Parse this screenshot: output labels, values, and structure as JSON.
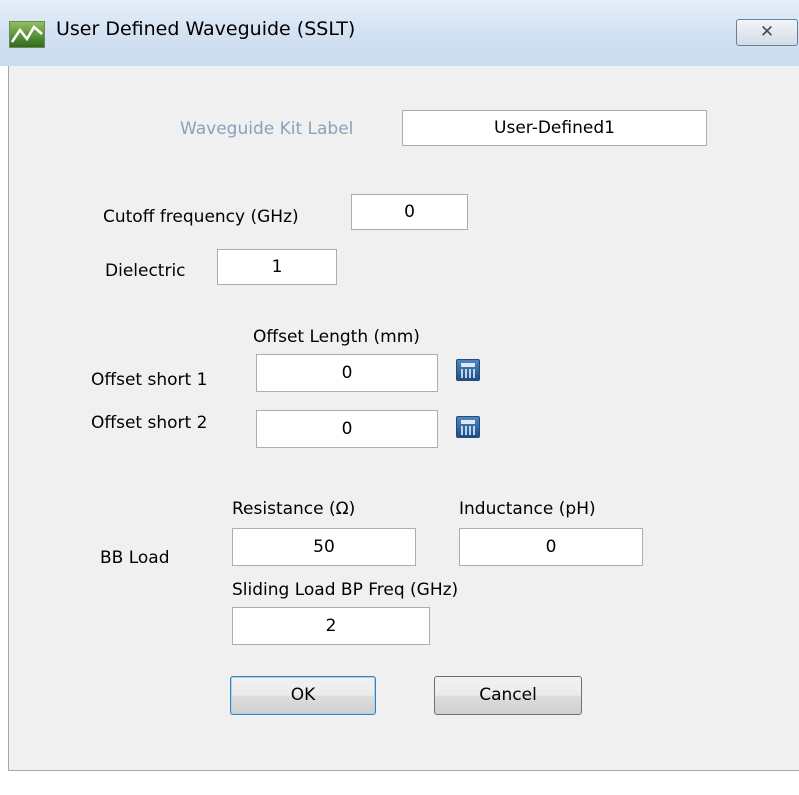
{
  "window": {
    "title": "User Defined Waveguide (SSLT)",
    "close_glyph": "✕",
    "icon": "app-icon"
  },
  "kit": {
    "label": "Waveguide Kit Label",
    "value": "User-Defined1"
  },
  "cutoff": {
    "label": "Cutoff frequency (GHz)",
    "value": "0"
  },
  "dielectric": {
    "label": "Dielectric",
    "value": "1"
  },
  "offset": {
    "header": "Offset Length (mm)",
    "short1_label": "Offset short 1",
    "short1_value": "0",
    "short2_label": "Offset short 2",
    "short2_value": "0",
    "calculator_icon": "calculator-icon"
  },
  "bb_load": {
    "label": "BB Load",
    "resistance_label": "Resistance (Ω)",
    "resistance_value": "50",
    "inductance_label": "Inductance (pH)",
    "inductance_value": "0",
    "sliding_label": "Sliding Load BP Freq (GHz)",
    "sliding_value": "2"
  },
  "buttons": {
    "ok": "OK",
    "cancel": "Cancel"
  },
  "colors": {
    "disabled_label": "#8aa1be",
    "titlebar": "#d3e2f3",
    "client_bg": "#f0f0f0"
  }
}
